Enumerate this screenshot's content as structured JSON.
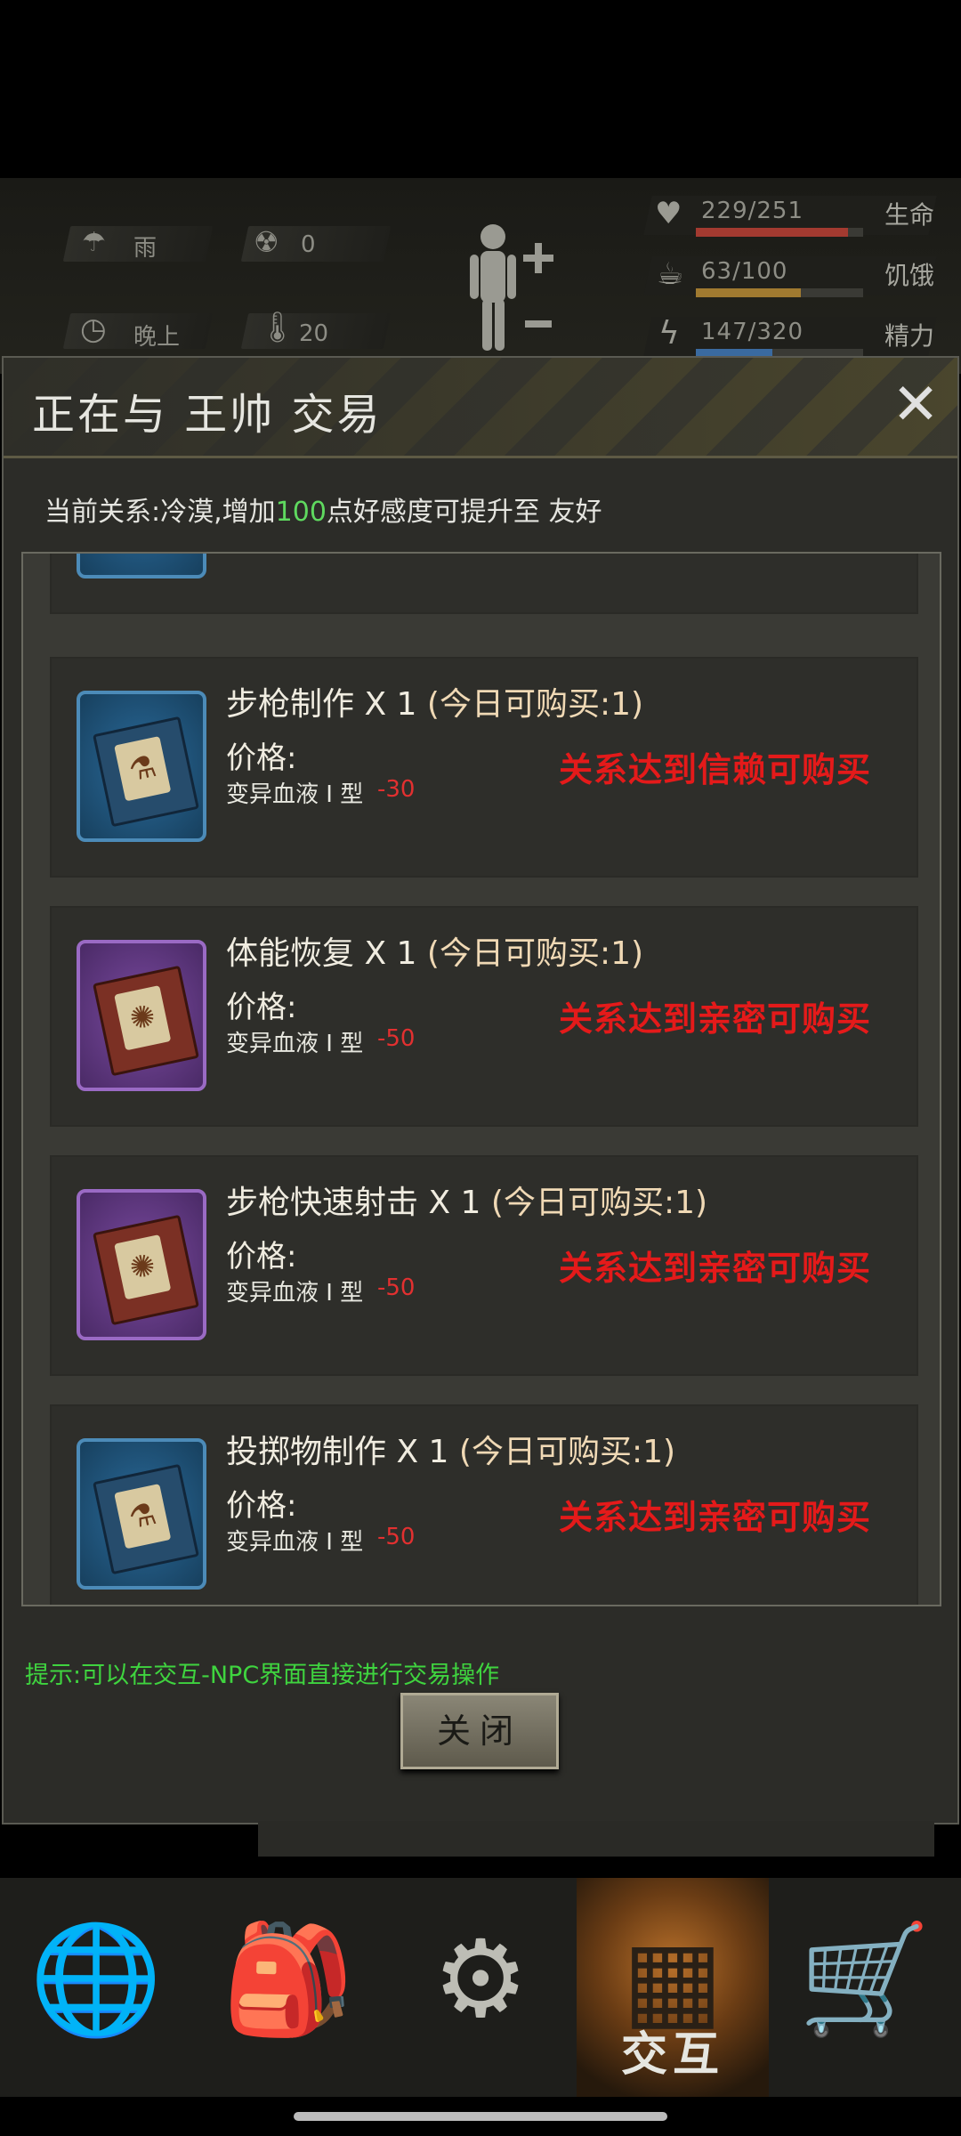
{
  "hud": {
    "weather": "雨",
    "radiation": "0",
    "time_of_day": "晚上",
    "temperature": "20",
    "stats": [
      {
        "value": "229/251",
        "label": "生命",
        "fraction": 0.91,
        "color": "#a33a30",
        "icon": "heart-icon"
      },
      {
        "value": "63/100",
        "label": "饥饿",
        "fraction": 0.63,
        "color": "#a07a30",
        "icon": "stomach-icon"
      },
      {
        "value": "147/320",
        "label": "精力",
        "fraction": 0.46,
        "color": "#3a6aa0",
        "icon": "energy-icon"
      }
    ]
  },
  "dialog": {
    "title": "正在与 王帅 交易",
    "relation_prefix": "当前关系:冷漠,增加",
    "relation_points": "100",
    "relation_suffix": "点好感度可提升至 友好",
    "items": [
      {
        "name": "步枪制作 X 1",
        "limit": "(今日可购买:1)",
        "price_label": "价格:",
        "currency": "变异血液 I 型",
        "cost": "-30",
        "requirement": "关系达到信赖可购买",
        "rarity": "blue"
      },
      {
        "name": "体能恢复 X 1",
        "limit": "(今日可购买:1)",
        "price_label": "价格:",
        "currency": "变异血液 I 型",
        "cost": "-50",
        "requirement": "关系达到亲密可购买",
        "rarity": "purple"
      },
      {
        "name": "步枪快速射击 X 1",
        "limit": "(今日可购买:1)",
        "price_label": "价格:",
        "currency": "变异血液 I 型",
        "cost": "-50",
        "requirement": "关系达到亲密可购买",
        "rarity": "purple"
      },
      {
        "name": "投掷物制作 X 1",
        "limit": "(今日可购买:1)",
        "price_label": "价格:",
        "currency": "变异血液 I 型",
        "cost": "-50",
        "requirement": "关系达到亲密可购买",
        "rarity": "blue"
      }
    ],
    "tip": "提示:可以在交互-NPC界面直接进行交易操作",
    "close_label": "关闭"
  },
  "bottom_nav": {
    "items": [
      {
        "icon": "globe-icon",
        "label": ""
      },
      {
        "icon": "backpack-icon",
        "label": ""
      },
      {
        "icon": "head-gear-icon",
        "label": ""
      },
      {
        "icon": "radio-icon",
        "label": "交互"
      },
      {
        "icon": "cart-icon",
        "label": ""
      }
    ]
  }
}
